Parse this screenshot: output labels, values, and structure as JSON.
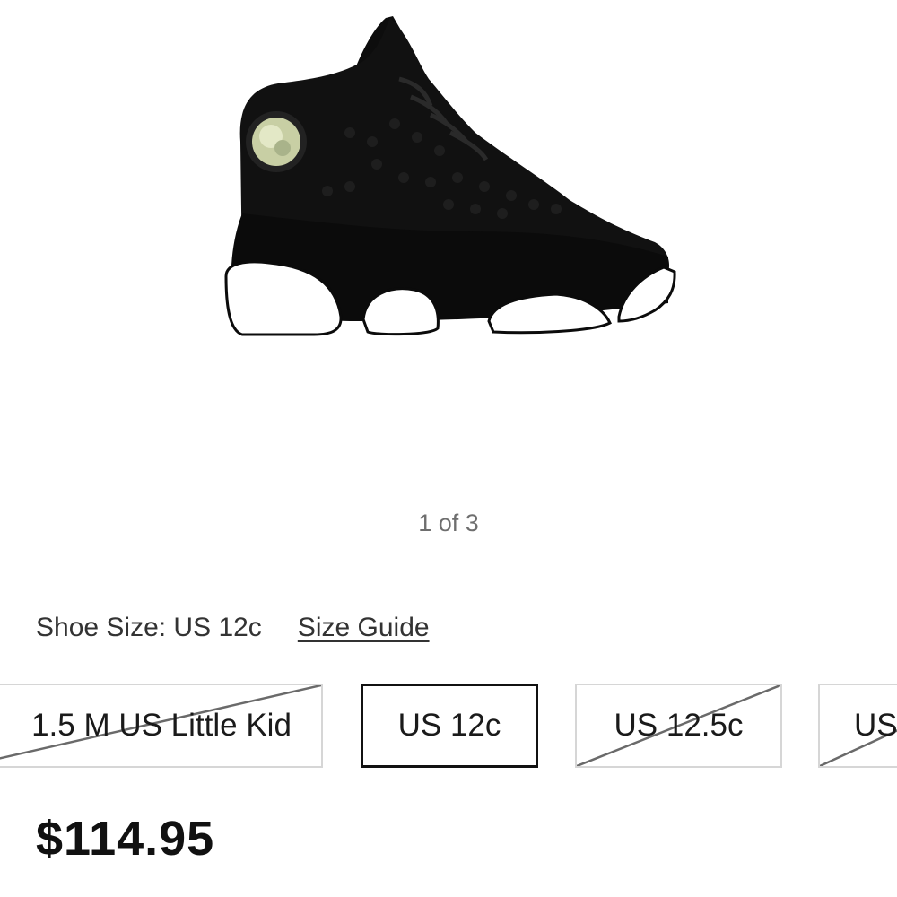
{
  "gallery": {
    "image": "black-high-top-sneaker",
    "counter": "1 of 3"
  },
  "size_selector": {
    "label": "Shoe Size: US 12c",
    "guide_link": "Size Guide",
    "options": [
      {
        "label": "1.5 M US Little Kid",
        "available": false,
        "selected": false
      },
      {
        "label": "US 12c",
        "available": true,
        "selected": true
      },
      {
        "label": "US 12.5c",
        "available": false,
        "selected": false
      },
      {
        "label": "US",
        "available": false,
        "selected": false
      }
    ]
  },
  "price": "$114.95",
  "colors": {
    "selected_border": "#111111",
    "unavailable_border": "#d6d6d6",
    "strike_line": "#6a6a6a"
  }
}
